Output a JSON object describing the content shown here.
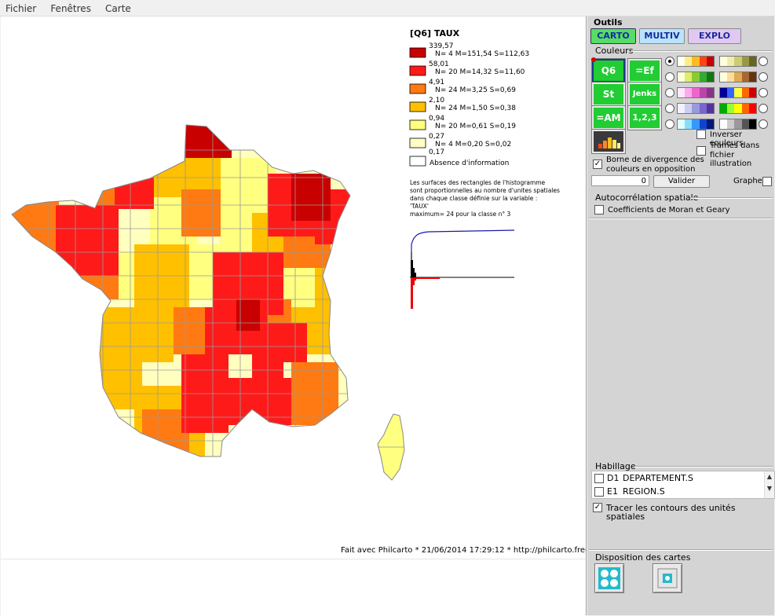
{
  "menu": [
    "Fichier",
    "Fenêtres",
    "Carte"
  ],
  "legend": {
    "title": "[Q6] TAUX",
    "classes": [
      {
        "upper": "339,57",
        "stats": "N= 4  M=151,54  S=112,63",
        "color": "#c80000"
      },
      {
        "upper": "58,01",
        "stats": "N= 20  M=14,32  S=11,60",
        "color": "#ff1a1a"
      },
      {
        "upper": "4,91",
        "stats": "N= 24  M=3,25  S=0,69",
        "color": "#ff7a12"
      },
      {
        "upper": "2,10",
        "stats": "N= 24  M=1,50  S=0,38",
        "color": "#ffc000"
      },
      {
        "upper": "0,94",
        "stats": "N= 20  M=0,61  S=0,19",
        "color": "#ffff80"
      },
      {
        "upper": "0,27",
        "stats": "N= 4  M=0,20  S=0,02",
        "color": "#ffffc4"
      }
    ],
    "min": "0,17",
    "missing": "Absence d'information",
    "note": [
      "Les surfaces des rectangles de l'histogramme",
      "sont proportionnelles au nombre d'unites spatiales",
      "dans chaque classe définie sur la variable :",
      "'TAUX'",
      "maximum= 24 pour la classe n° 3"
    ]
  },
  "footer": "Fait avec Philcarto * 21/06/2014 17:29:12 * http://philcarto.free.fr",
  "panel": {
    "outils": "Outils",
    "tabs": [
      "CARTO",
      "MULTIV",
      "EXPLO"
    ],
    "couleurs": "Couleurs",
    "method_buttons": [
      "Q6",
      "=Ef",
      "St",
      "Jenks",
      "=AM",
      "1,2,3"
    ],
    "palettes_left": [
      [
        "#fffff0",
        "#ffee88",
        "#ffbb22",
        "#ff4411",
        "#c80000"
      ],
      [
        "#ffffe0",
        "#ddee66",
        "#88cc33",
        "#33aa33",
        "#117711"
      ],
      [
        "#ffe8ff",
        "#ffaaee",
        "#ee66cc",
        "#bb44aa",
        "#883388"
      ],
      [
        "#f0f0ff",
        "#ccccee",
        "#9999dd",
        "#7766cc",
        "#553399"
      ],
      [
        "#e0ffff",
        "#88ddff",
        "#3399ff",
        "#1144cc",
        "#001a77"
      ]
    ],
    "palettes_right": [
      [
        "#ffffe0",
        "#eeeeaa",
        "#cccc77",
        "#999944",
        "#666622"
      ],
      [
        "#ffffe0",
        "#ffdd99",
        "#ddaa55",
        "#aa6633",
        "#663311"
      ],
      [
        "#000099",
        "#3366ff",
        "#ffff44",
        "#ff6600",
        "#cc0000"
      ],
      [
        "#00aa00",
        "#99ff33",
        "#ffff00",
        "#ff6600",
        "#ff0000"
      ],
      [
        "#ffffff",
        "#cccccc",
        "#999999",
        "#555555",
        "#000000"
      ]
    ],
    "inverser": "Inverser couleurs",
    "trames": [
      "Trames dans",
      "fichier illustration"
    ],
    "borne": [
      "Borne de divergence des",
      "couleurs en opposition"
    ],
    "borne_value": "0",
    "valider": "Valider",
    "graphe": "Graphe",
    "autocorr": "Autocorrélation spatiale",
    "moran": "Coefficients de Moran et Geary",
    "habillage": "Habillage",
    "layers": [
      {
        "code": "D1",
        "name": "DEPARTEMENT.S"
      },
      {
        "code": "E1",
        "name": "REGION.S"
      }
    ],
    "contours": "Tracer les contours des unités spatiales",
    "disposition": "Disposition des cartes"
  }
}
